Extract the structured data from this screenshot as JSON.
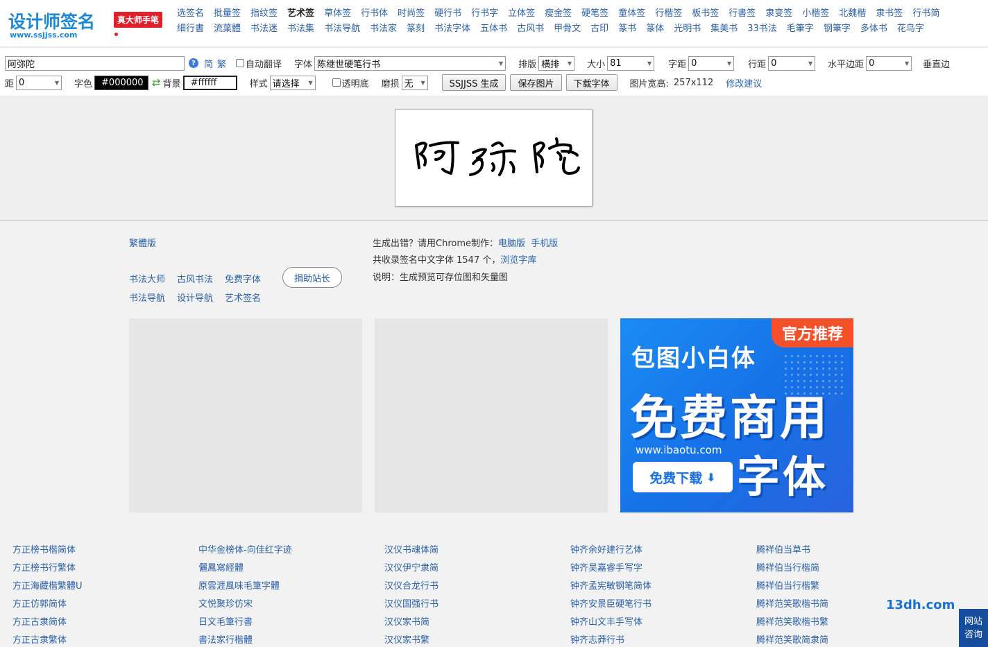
{
  "logo": {
    "title": "设计师签名",
    "badge": "真大师手笔",
    "url": "www.ssjjss.com"
  },
  "nav": {
    "row1": [
      "选签名",
      "批量签",
      "指纹签",
      "艺术签",
      "草体签",
      "行书体",
      "时尚签",
      "硬行书",
      "行书字",
      "立体签",
      "瘦金签",
      "硬笔签",
      "童体签",
      "行楷签",
      "板书签",
      "行書签",
      "隶变签",
      "小楷签",
      "北魏楷",
      "隶书签",
      "行书简"
    ],
    "row2": [
      "細行書",
      "流葉體",
      "书法迷",
      "书法集",
      "书法导航",
      "书法家",
      "篆刻",
      "书法字体",
      "五体书",
      "古风书",
      "甲骨文",
      "古印",
      "篆书",
      "篆体",
      "光明书",
      "集美书",
      "33书法",
      "毛筆字",
      "钢筆字",
      "多体书",
      "花鸟字"
    ],
    "active_index": 3
  },
  "toolbar": {
    "text_value": "阿弥陀",
    "help_icon": "help-icon",
    "simplified": "简",
    "traditional": "繁",
    "auto_translate": "自动翻译",
    "font_label": "字体",
    "font_value": "陈继世硬笔行书",
    "layout_label": "排版",
    "layout_value": "横排",
    "size_label": "大小",
    "size_value": "81",
    "char_spacing_label": "字距",
    "char_spacing_value": "0",
    "line_spacing_label": "行距",
    "line_spacing_value": "0",
    "h_margin_label": "水平边距",
    "h_margin_value": "0",
    "v_margin_label_a": "垂直边",
    "v_margin_label_b": "距",
    "v_margin_value": "0",
    "color_label": "字色",
    "color_value": "#000000",
    "swap_icon": "swap-icon",
    "bg_label": "背景",
    "bg_value": "#ffffff",
    "style_label": "样式",
    "style_value": "请选择",
    "transparent_label": "透明底",
    "wear_label": "磨损",
    "wear_value": "无",
    "generate_button": "SSJJSS 生成",
    "save_button": "保存图片",
    "download_button": "下载字体",
    "image_size_label": "图片宽高:",
    "image_size_value": "257x112",
    "suggest_link": "修改建议"
  },
  "info": {
    "traditional_link": "繁體版",
    "links_row1": [
      "书法大师",
      "古风书法",
      "免费字体"
    ],
    "links_row2": [
      "书法导航",
      "设计导航",
      "艺术签名"
    ],
    "donate_button": "捐助站长",
    "error_text": "生成出错？请用Chrome制作：",
    "pc_link": "电脑版",
    "mobile_link": "手机版",
    "count_text": "共收录签名中文字体 1547 个，",
    "browse_link": "浏览字库",
    "note_text": "说明：生成预览可存位图和矢量图"
  },
  "ad": {
    "badge": "官方推荐",
    "title": "包图小白体",
    "big": "免费商用",
    "url": "www.ibaotu.com",
    "download": "免费下载",
    "download_icon": "download-arrow-icon",
    "sub": "字体"
  },
  "font_list": [
    [
      "方正榜书楷简体",
      "方正榜书行繁体",
      "方正海藏楷繁體U",
      "方正仿郭简体",
      "方正古隶简体",
      "方正古隶繁体"
    ],
    [
      "中华金榜体-向佳红字迹",
      "儷鳳寫經體",
      "原雲涯風味毛筆字體",
      "文悦聚珍仿宋",
      "日文毛筆行書",
      "書法家行楷體"
    ],
    [
      "汉仪书魂体简",
      "汉仪伊宁隶简",
      "汉仪合龙行书",
      "汉仪国强行书",
      "汉仪家书简",
      "汉仪家书繁"
    ],
    [
      "钟齐余好建行艺体",
      "钟齐吴嘉睿手写字",
      "钟齐孟宪敏钢笔简体",
      "钟齐安景臣硬笔行书",
      "钟齐山文丰手写体",
      "钟齐志莽行书"
    ],
    [
      "腾祥伯当草书",
      "腾祥伯当行楷简",
      "腾祥伯当行楷繁",
      "腾祥范笑歌楷书简",
      "腾祥范笑歌楷书繁",
      "腾祥范笑歌简隶简"
    ]
  ],
  "side": {
    "brand": "13dh.com",
    "consult_line1": "网站",
    "consult_line2": "咨询"
  }
}
